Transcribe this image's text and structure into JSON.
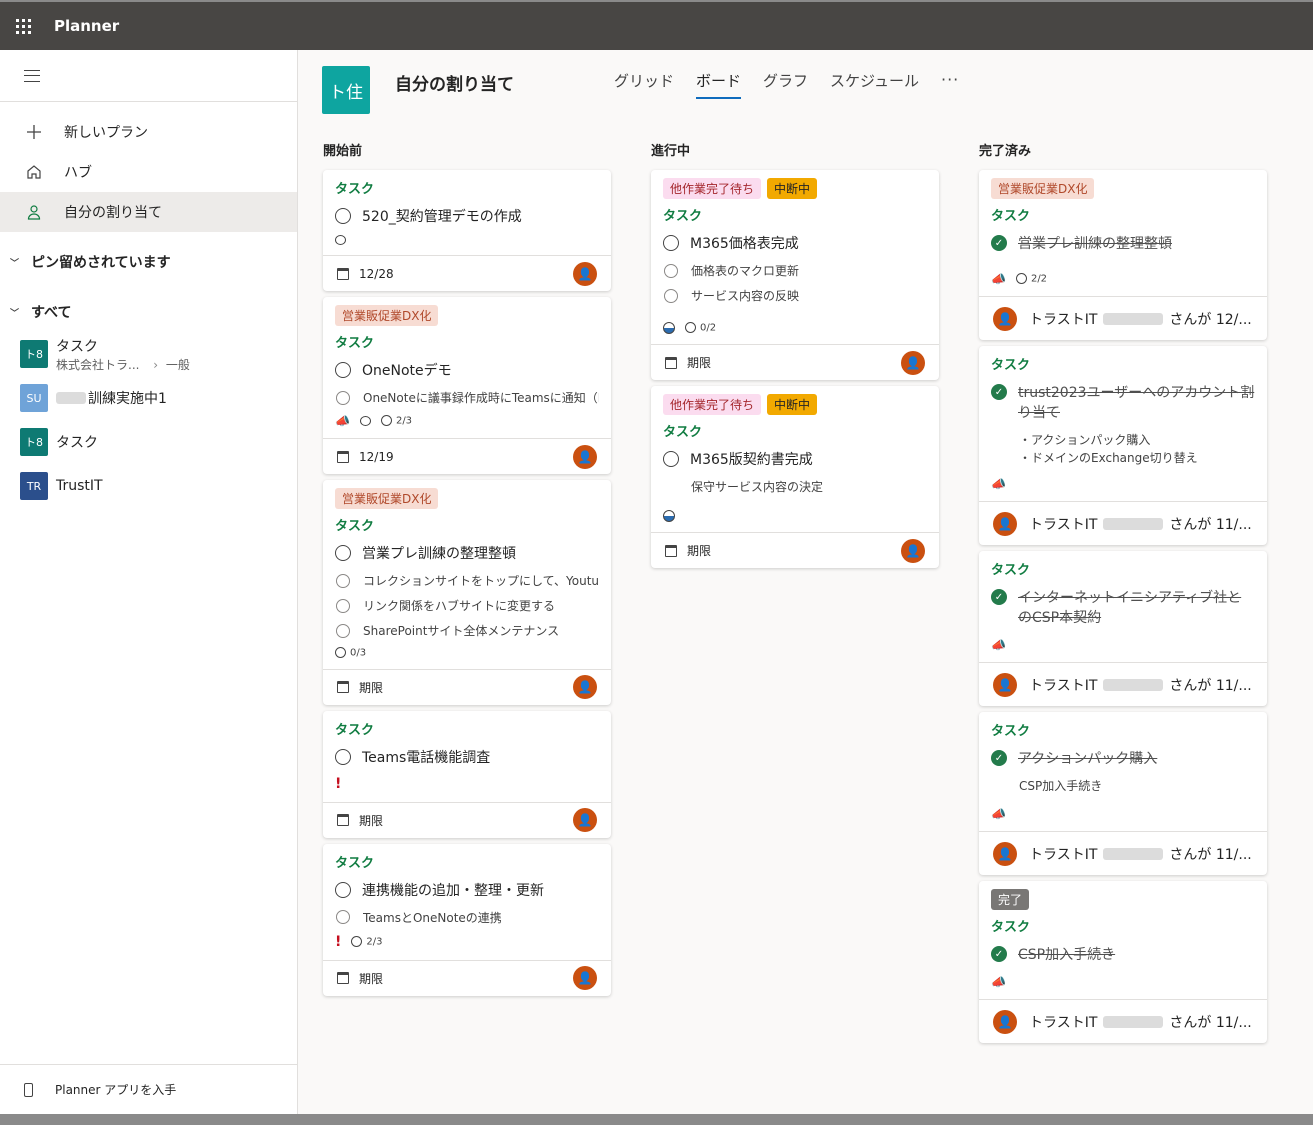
{
  "app": {
    "title": "Planner"
  },
  "sidebar": {
    "nav": [
      {
        "label": "新しいプラン",
        "icon": "plus-icon"
      },
      {
        "label": "ハブ",
        "icon": "home-icon"
      },
      {
        "label": "自分の割り当て",
        "icon": "person-icon"
      }
    ],
    "pinned_label": "ピン留めされています",
    "all_label": "すべて",
    "plans": [
      {
        "name": "タスク",
        "sub": "株式会社トラ...",
        "channel": "一般",
        "avatar": "ト8",
        "color": "#0e7a73"
      },
      {
        "name": "訓練実施中1",
        "avatar": "SU",
        "color": "#6fa3d8"
      },
      {
        "name": "タスク",
        "avatar": "ト8",
        "color": "#0e7a73"
      },
      {
        "name": "TrustIT",
        "avatar": "TR",
        "color": "#2b4f8c"
      }
    ],
    "footer": "Planner アプリを入手"
  },
  "header": {
    "logo": "ト住",
    "title": "自分の割り当て",
    "tabs": [
      "グリッド",
      "ボード",
      "グラフ",
      "スケジュール"
    ],
    "more": "···"
  },
  "columns": {
    "notstarted": {
      "title": "開始前",
      "cards": [
        {
          "bucket": "タスク",
          "title": "520_契約管理デモの作成",
          "comment": true,
          "due": "12/28"
        },
        {
          "label": "営業販促業DX化",
          "bucket": "タスク",
          "title": "OneNoteデモ",
          "subtasks": [
            "OneNoteに議事録作成時にTeamsに通知（Pc"
          ],
          "checklist": "2/3",
          "due": "12/19"
        },
        {
          "label": "営業販促業DX化",
          "bucket": "タスク",
          "title": "営業プレ訓練の整理整頓",
          "subtasks": [
            "コレクションサイトをトップにして、Youtul",
            "リンク関係をハブサイトに変更する",
            "SharePointサイト全体メンテナンス"
          ],
          "checklist": "0/3",
          "due": "期限"
        },
        {
          "bucket": "タスク",
          "title": "Teams電話機能調査",
          "important": "!",
          "due": "期限"
        },
        {
          "bucket": "タスク",
          "title": "連携機能の追加・整理・更新",
          "subtasks": [
            "TeamsとOneNoteの連携"
          ],
          "important": "!",
          "checklist": "2/3",
          "due": "期限"
        }
      ]
    },
    "inprogress": {
      "title": "進行中",
      "cards": [
        {
          "labels": [
            "他作業完了待ち",
            "中断中"
          ],
          "bucket": "タスク",
          "title": "M365価格表完成",
          "subtasks": [
            "価格表のマクロ更新",
            "サービス内容の反映"
          ],
          "checklist": "0/2",
          "due": "期限"
        },
        {
          "labels": [
            "他作業完了待ち",
            "中断中"
          ],
          "bucket": "タスク",
          "title": "M365版契約書完成",
          "desc": "保守サービス内容の決定",
          "due": "期限"
        }
      ]
    },
    "completed": {
      "title": "完了済み",
      "cards": [
        {
          "label": "営業販促業DX化",
          "bucket": "タスク",
          "title": "営業プレ訓練の整理整頓",
          "checklist": "2/2",
          "who": "トラストIT",
          "after": "さんが 12/..."
        },
        {
          "bucket": "タスク",
          "title": "trust2023ユーザーへのアカウント割り当て",
          "desc": "・アクションパック購入\n・ドメインのExchange切り替え",
          "who": "トラストIT",
          "after": "さんが 11/..."
        },
        {
          "bucket": "タスク",
          "title": "インターネットイニシアティブ社とのCSP本契約",
          "who": "トラストIT",
          "after": "さんが 11/..."
        },
        {
          "bucket": "タスク",
          "title": "アクションパック購入",
          "desc": "CSP加入手続き",
          "who": "トラストIT",
          "after": "さんが 11/..."
        },
        {
          "label": "完了",
          "bucket": "タスク",
          "title": "CSP加入手続き",
          "who": "トラストIT",
          "after": "さんが 11/..."
        }
      ]
    }
  },
  "colors": {
    "bucket": "#107c41",
    "accent": "#0f6cbd",
    "avatar": "#ca5010",
    "done": "#237b4b"
  }
}
